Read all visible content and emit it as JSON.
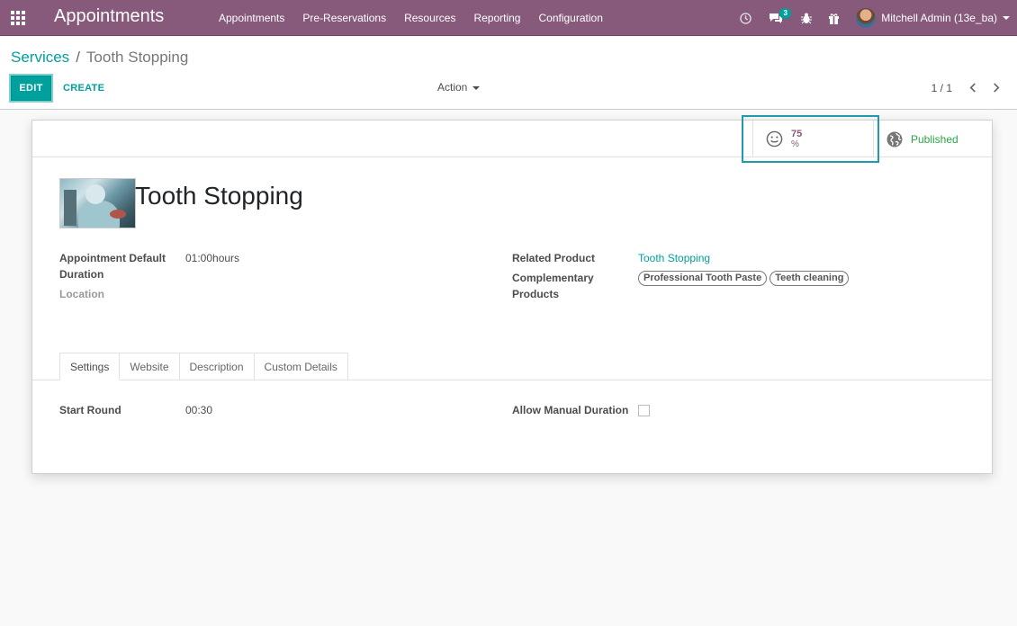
{
  "navbar": {
    "brand": "Appointments",
    "menu": [
      "Appointments",
      "Pre-Reservations",
      "Resources",
      "Reporting",
      "Configuration"
    ],
    "messages_count": "3",
    "user_name": "Mitchell Admin (13e_ba)"
  },
  "breadcrumb": {
    "parent": "Services",
    "separator": "/",
    "current": "Tooth Stopping"
  },
  "toolbar": {
    "edit_label": "EDIT",
    "create_label": "CREATE",
    "action_label": "Action",
    "pager": "1 / 1"
  },
  "smart_buttons": {
    "rating_value": "75",
    "rating_unit": "%",
    "publish_label": "Published"
  },
  "record": {
    "title": "Tooth Stopping",
    "fields": {
      "duration_label": "Appointment Default Duration",
      "duration_value": "01:00hours",
      "location_label": "Location",
      "related_product_label": "Related Product",
      "related_product_value": "Tooth Stopping",
      "complementary_label": "Complementary Products",
      "complementary_tags": [
        "Professional Tooth Paste",
        "Teeth cleaning"
      ]
    }
  },
  "tabs": [
    "Settings",
    "Website",
    "Description",
    "Custom Details"
  ],
  "settings": {
    "start_round_label": "Start Round",
    "start_round_value": "00:30",
    "allow_manual_label": "Allow Manual Duration"
  },
  "colors": {
    "navbar": "#875a7b",
    "accent": "#00a09d",
    "published": "#28a745"
  }
}
